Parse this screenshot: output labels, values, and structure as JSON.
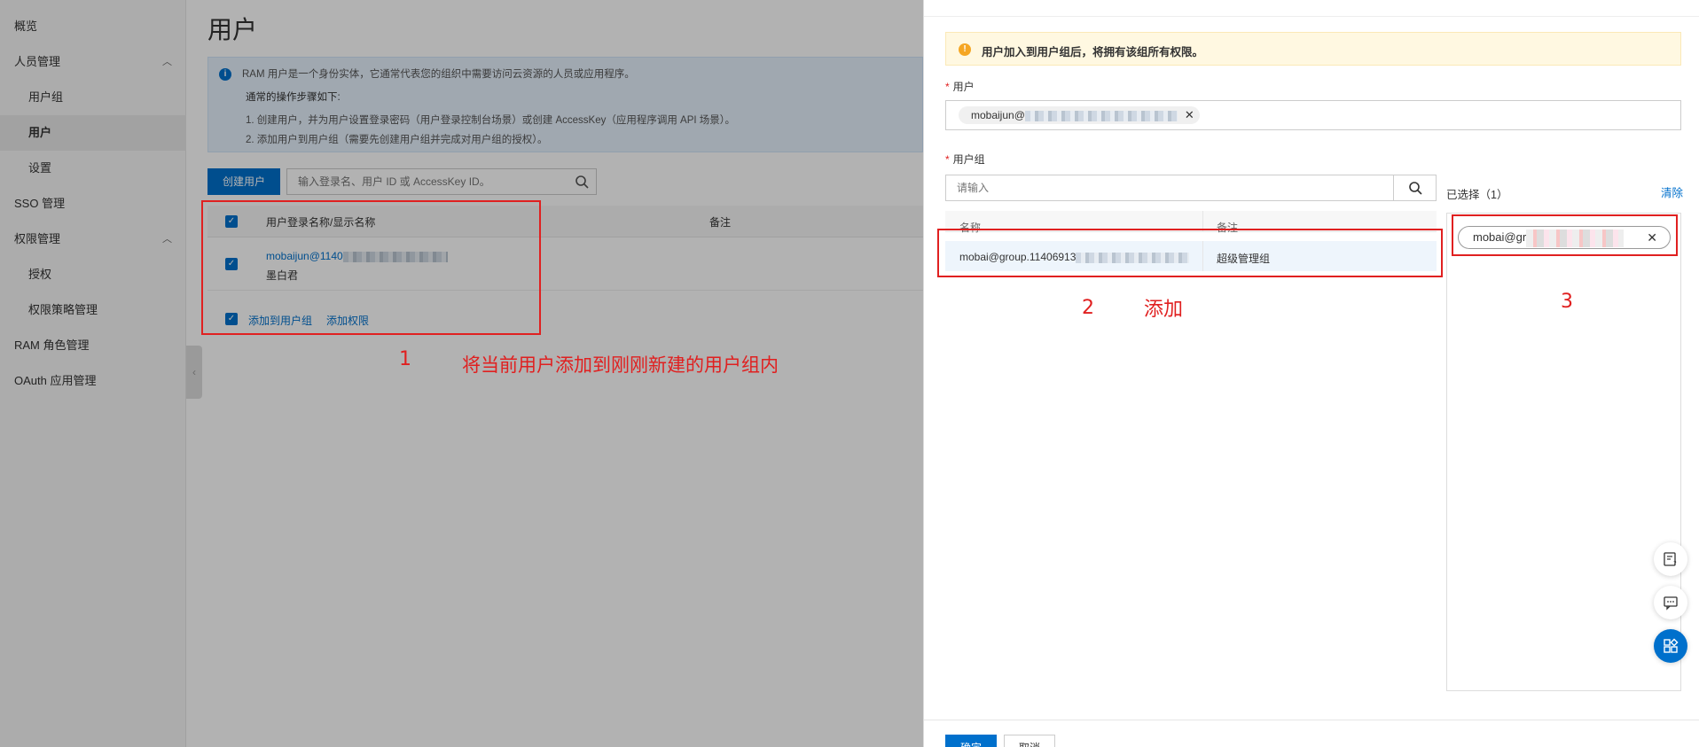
{
  "sidebar": {
    "items": [
      {
        "label": "概览",
        "type": "top"
      },
      {
        "label": "人员管理",
        "type": "group"
      },
      {
        "label": "用户组",
        "type": "sub"
      },
      {
        "label": "用户",
        "type": "sub",
        "active": true
      },
      {
        "label": "设置",
        "type": "sub"
      },
      {
        "label": "SSO 管理",
        "type": "top"
      },
      {
        "label": "权限管理",
        "type": "group"
      },
      {
        "label": "授权",
        "type": "sub"
      },
      {
        "label": "权限策略管理",
        "type": "sub"
      },
      {
        "label": "RAM 角色管理",
        "type": "top"
      },
      {
        "label": "OAuth 应用管理",
        "type": "top"
      }
    ]
  },
  "main": {
    "title": "用户",
    "info": {
      "line1": "RAM 用户是一个身份实体，它通常代表您的组织中需要访问云资源的人员或应用程序。",
      "line2": "通常的操作步骤如下:",
      "line3": "1. 创建用户，并为用户设置登录密码（用户登录控制台场景）或创建 AccessKey（应用程序调用 API 场景）。",
      "line4": "2. 添加用户到用户组（需要先创建用户组并完成对用户组的授权）。"
    },
    "create_button": "创建用户",
    "search_placeholder": "输入登录名、用户 ID 或 AccessKey ID。",
    "table": {
      "col_name": "用户登录名称/显示名称",
      "col_note": "备注",
      "row": {
        "login": "mobaijun@1140",
        "display": "墨白君"
      }
    },
    "footer_actions": {
      "add_to_group": "添加到用户组",
      "add_permission": "添加权限"
    }
  },
  "annotations": {
    "num1": "1",
    "text1": "将当前用户添加到刚刚新建的用户组内",
    "num2": "2",
    "text2": "添加",
    "num3": "3",
    "color": "#e02020"
  },
  "drawer": {
    "warning": "用户加入到用户组后，将拥有该组所有权限。",
    "user_label": "用户",
    "user_tag": "mobaijun@",
    "group_label": "用户组",
    "group_search_placeholder": "请输入",
    "group_table": {
      "col_name": "名称",
      "col_note": "备注",
      "row": {
        "name": "mobai@group.11406913",
        "note": "超级管理组"
      }
    },
    "selected_title": "已选择（1）",
    "clear": "清除",
    "selected_tag": "mobai@gr",
    "ok_button": "确定",
    "cancel_button": "取消"
  },
  "colors": {
    "primary": "#0070cc",
    "annotation": "#e02020",
    "warning_bg": "#fff8e1"
  }
}
